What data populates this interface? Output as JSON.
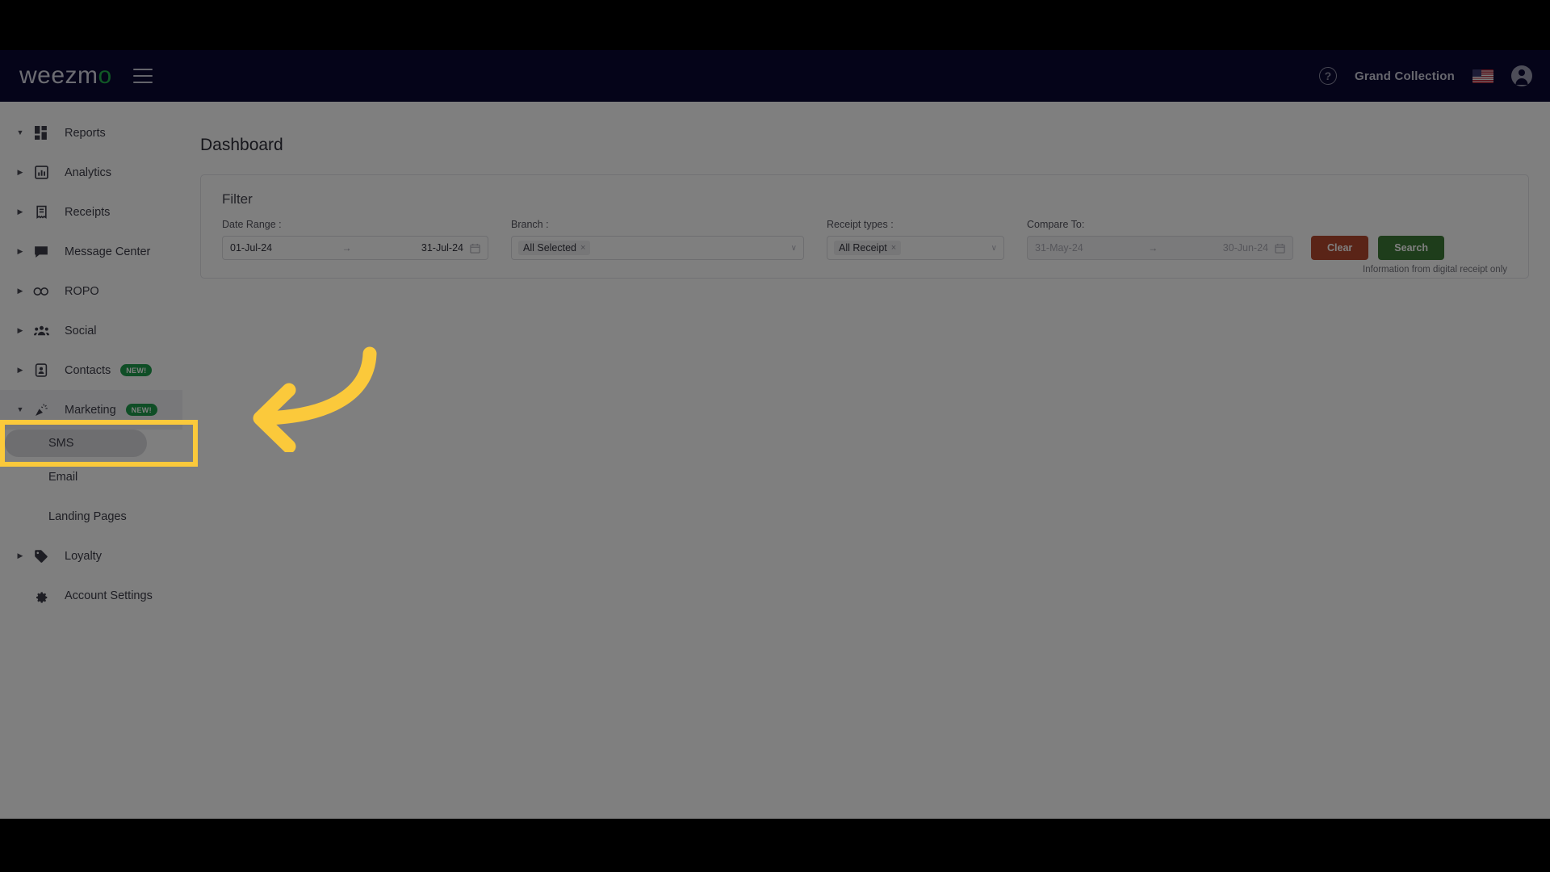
{
  "topbar": {
    "logo_main": "weezm",
    "logo_accent": "o",
    "menu_icon": "hamburger-icon",
    "help_icon": "?",
    "org_name": "Grand Collection",
    "locale_flag": "us-flag",
    "account_icon": "account-avatar"
  },
  "sidebar": {
    "items": [
      {
        "label": "Reports",
        "icon": "dashboard-grid-icon",
        "caret": "down",
        "badge": ""
      },
      {
        "label": "Analytics",
        "icon": "bar-chart-icon",
        "caret": "right",
        "badge": ""
      },
      {
        "label": "Receipts",
        "icon": "receipt-icon",
        "caret": "right",
        "badge": ""
      },
      {
        "label": "Message Center",
        "icon": "chat-bubble-icon",
        "caret": "right",
        "badge": ""
      },
      {
        "label": "ROPO",
        "icon": "infinity-icon",
        "caret": "right",
        "badge": ""
      },
      {
        "label": "Social",
        "icon": "people-icon",
        "caret": "right",
        "badge": ""
      },
      {
        "label": "Contacts",
        "icon": "contact-card-icon",
        "caret": "right",
        "badge": "NEW!"
      },
      {
        "label": "Marketing",
        "icon": "megaphone-icon",
        "caret": "down",
        "badge": "NEW!"
      }
    ],
    "marketing_children": [
      {
        "label": "SMS",
        "selected": true
      },
      {
        "label": "Email",
        "selected": false
      },
      {
        "label": "Landing Pages",
        "selected": false
      }
    ],
    "tail_items": [
      {
        "label": "Loyalty",
        "icon": "tag-icon",
        "caret": "right",
        "badge": ""
      },
      {
        "label": "Account Settings",
        "icon": "gear-icon",
        "caret": "blank",
        "badge": ""
      }
    ]
  },
  "main": {
    "page_title": "Dashboard",
    "filter": {
      "title": "Filter",
      "date_range": {
        "label": "Date Range :",
        "start": "01-Jul-24",
        "arrow": "→",
        "end": "31-Jul-24",
        "calendar_icon": "calendar-icon"
      },
      "branch": {
        "label": "Branch :",
        "tag": "All Selected",
        "remove_icon": "×",
        "chevron": "∨"
      },
      "receipt_types": {
        "label": "Receipt types :",
        "tag": "All Receipt",
        "remove_icon": "×",
        "chevron": "∨"
      },
      "compare_to": {
        "label": "Compare To:",
        "start_placeholder": "31-May-24",
        "arrow": "→",
        "end_placeholder": "30-Jun-24",
        "calendar_icon": "calendar-icon"
      },
      "clear_button": "Clear",
      "search_button": "Search",
      "note": "Information from digital receipt only"
    }
  },
  "annotation": {
    "highlight_color": "#fbc93b",
    "arrow_color": "#fbc93b",
    "target": "SMS"
  }
}
